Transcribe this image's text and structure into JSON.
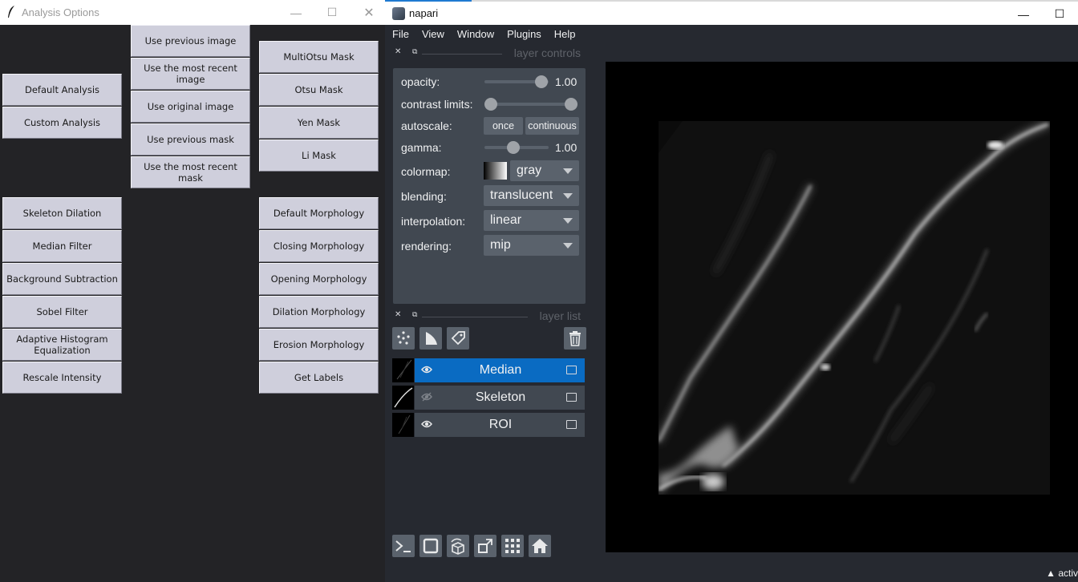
{
  "analysis_window": {
    "title": "Analysis Options",
    "controls": {
      "minimize": "—",
      "maximize": "☐",
      "close": "✕"
    },
    "column_left": [
      "Default Analysis",
      "Custom Analysis"
    ],
    "column_left_lower": [
      "Skeleton Dilation",
      "Median Filter",
      "Background Subtraction",
      "Sobel Filter",
      "Adaptive Histogram Equalization",
      "Rescale Intensity"
    ],
    "column_middle": [
      "Use previous image",
      "Use the most recent image",
      "Use original image",
      "Use previous mask",
      "Use the most recent mask"
    ],
    "column_right": [
      "MultiOtsu Mask",
      "Otsu Mask",
      "Yen Mask",
      "Li Mask"
    ],
    "column_right_lower": [
      "Default Morphology",
      "Closing Morphology",
      "Opening Morphology",
      "Dilation Morphology",
      "Erosion Morphology",
      "Get Labels"
    ]
  },
  "napari": {
    "title": "napari",
    "menu": [
      "File",
      "View",
      "Window",
      "Plugins",
      "Help"
    ],
    "layer_controls": {
      "header": "layer controls",
      "opacity_label": "opacity:",
      "opacity_value": "1.00",
      "opacity_level": 1.0,
      "contrast_label": "contrast limits:",
      "autoscale_label": "autoscale:",
      "autoscale_once": "once",
      "autoscale_continuous": "continuous",
      "gamma_label": "gamma:",
      "gamma_value": "1.00",
      "colormap_label": "colormap:",
      "colormap_value": "gray",
      "blending_label": "blending:",
      "blending_value": "translucent",
      "interpolation_label": "interpolation:",
      "interpolation_value": "linear",
      "rendering_label": "rendering:",
      "rendering_value": "mip"
    },
    "layer_list": {
      "header": "layer list",
      "layers": [
        {
          "name": "Median",
          "selected": true,
          "visible": true
        },
        {
          "name": "Skeleton",
          "selected": false,
          "visible": false
        },
        {
          "name": "ROI",
          "selected": false,
          "visible": true
        }
      ]
    },
    "status_text": "activ",
    "colors": {
      "background": "#262930",
      "panel": "#414851",
      "selected": "#0a6bc2",
      "control": "#5a626c"
    }
  }
}
